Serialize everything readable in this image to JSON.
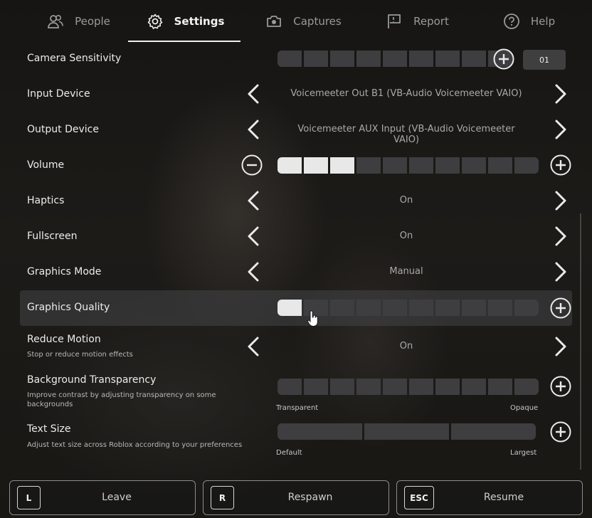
{
  "tabs": [
    {
      "label": "People",
      "icon": "people-icon"
    },
    {
      "label": "Settings",
      "icon": "gear-icon"
    },
    {
      "label": "Captures",
      "icon": "camera-icon"
    },
    {
      "label": "Report",
      "icon": "flag-icon"
    },
    {
      "label": "Help",
      "icon": "help-icon"
    }
  ],
  "active_tab": "Settings",
  "settings": {
    "camera_sensitivity": {
      "label": "Camera Sensitivity",
      "value": "01",
      "segments": 10,
      "filled": 0
    },
    "input_device": {
      "label": "Input Device",
      "value": "Voicemeeter Out B1 (VB-Audio Voicemeeter VAIO)"
    },
    "output_device": {
      "label": "Output Device",
      "value": "Voicemeeter AUX Input (VB-Audio Voicemeeter VAIO)"
    },
    "volume": {
      "label": "Volume",
      "segments": 10,
      "filled": 3
    },
    "haptics": {
      "label": "Haptics",
      "value": "On"
    },
    "fullscreen": {
      "label": "Fullscreen",
      "value": "On"
    },
    "graphics_mode": {
      "label": "Graphics Mode",
      "value": "Manual"
    },
    "graphics_quality": {
      "label": "Graphics Quality",
      "segments": 10,
      "filled": 1
    },
    "reduce_motion": {
      "label": "Reduce Motion",
      "description": "Stop or reduce motion effects",
      "value": "On"
    },
    "background_transparency": {
      "label": "Background Transparency",
      "description": "Improve contrast by adjusting transparency on some backgrounds",
      "segments": 10,
      "filled": 0,
      "min_label": "Transparent",
      "max_label": "Opaque"
    },
    "text_size": {
      "label": "Text Size",
      "description": "Adjust text size across Roblox according to your preferences",
      "segments": 3,
      "filled": 0,
      "min_label": "Default",
      "max_label": "Largest"
    }
  },
  "bottom_buttons": [
    {
      "key": "L",
      "label": "Leave"
    },
    {
      "key": "R",
      "label": "Respawn"
    },
    {
      "key": "ESC",
      "label": "Resume"
    }
  ],
  "colors": {
    "segment_on": "#e8e8e8",
    "segment_off": "#3e3e40",
    "highlight_row": "#464648"
  }
}
